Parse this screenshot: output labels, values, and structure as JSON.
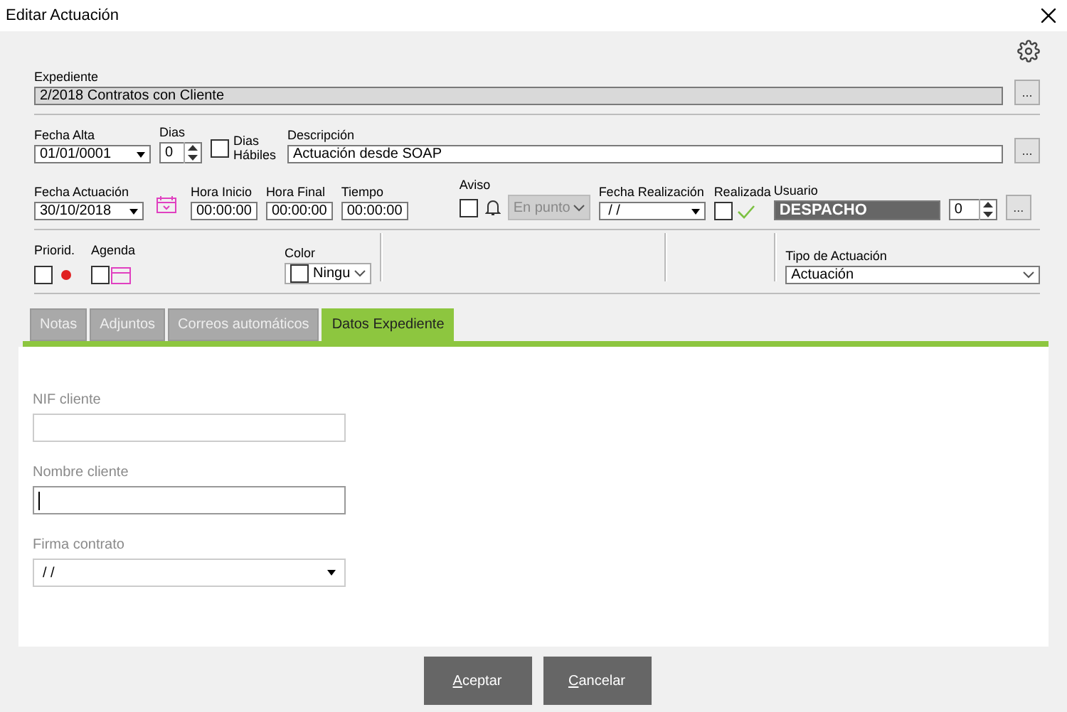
{
  "window": {
    "title": "Editar Actuación"
  },
  "expediente": {
    "label": "Expediente",
    "value": "2/2018 Contratos con Cliente",
    "button": "..."
  },
  "fecha_alta": {
    "label": "Fecha Alta",
    "value": "01/01/0001"
  },
  "dias": {
    "label": "Dias",
    "value": "0"
  },
  "dias_habiles": {
    "label": "Dias Hábiles",
    "checked": false
  },
  "descripcion": {
    "label": "Descripción",
    "value": "Actuación desde SOAP",
    "button": "..."
  },
  "fecha_actuacion": {
    "label": "Fecha Actuación",
    "value": "30/10/2018"
  },
  "hora_inicio": {
    "label": "Hora Inicio",
    "value": "00:00:00"
  },
  "hora_final": {
    "label": "Hora Final",
    "value": "00:00:00"
  },
  "tiempo": {
    "label": "Tiempo",
    "value": "00:00:00"
  },
  "aviso": {
    "label": "Aviso",
    "checked": false,
    "option": "En punto",
    "disabled": true
  },
  "fecha_realizacion": {
    "label": "Fecha Realización",
    "value": " / /"
  },
  "realizada": {
    "label": "Realizada",
    "checked": false
  },
  "usuario": {
    "label": "Usuario",
    "value": "DESPACHO",
    "number": "0",
    "button": "..."
  },
  "prioridad": {
    "label": "Priorid.",
    "checked": false
  },
  "agenda": {
    "label": "Agenda",
    "checked": false
  },
  "color": {
    "label": "Color",
    "value": "Ningu"
  },
  "tipo": {
    "label": "Tipo de Actuación",
    "value": "Actuación"
  },
  "tabs": [
    {
      "label": "Notas",
      "selected": false
    },
    {
      "label": "Adjuntos",
      "selected": false
    },
    {
      "label": "Correos automáticos",
      "selected": false
    },
    {
      "label": "Datos Expediente",
      "selected": true
    }
  ],
  "form": [
    {
      "label": "NIF cliente",
      "kind": "text"
    },
    {
      "label": "Nombre cliente",
      "kind": "text",
      "focused": true
    },
    {
      "label": "Firma contrato",
      "kind": "date",
      "value": "/ /"
    }
  ],
  "buttons": [
    {
      "label": "Aceptar"
    },
    {
      "label": "Cancelar"
    }
  ]
}
